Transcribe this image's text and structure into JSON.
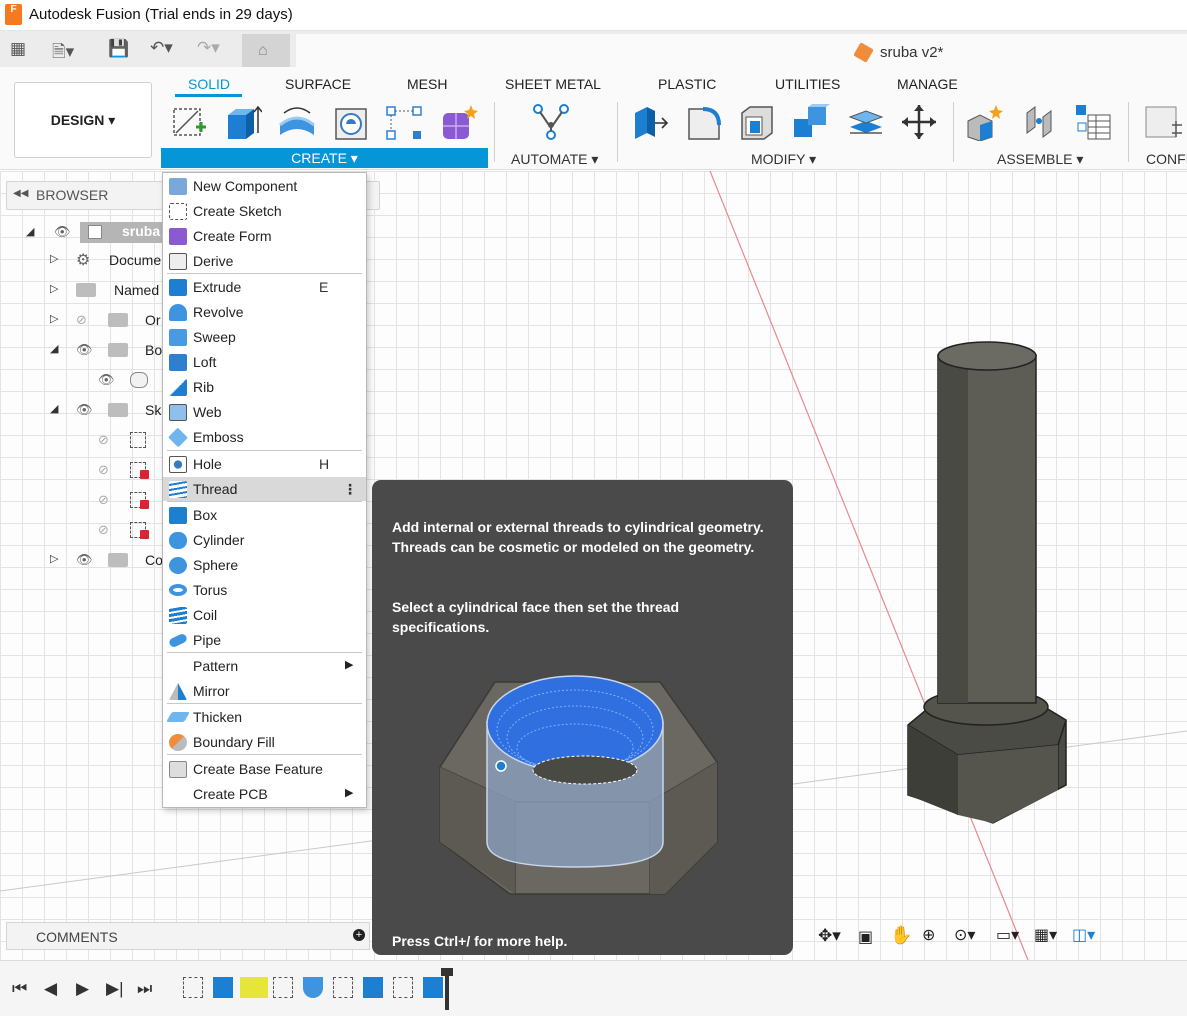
{
  "window": {
    "title": "Autodesk Fusion (Trial ends in 29 days)",
    "app_icon_text": "F"
  },
  "quick_access": {
    "icons": [
      "grid-icon",
      "file-icon",
      "save-icon",
      "undo-icon",
      "redo-icon",
      "home-icon"
    ]
  },
  "document": {
    "title": "sruba v2*"
  },
  "ribbon": {
    "tabs": [
      "SOLID",
      "SURFACE",
      "MESH",
      "SHEET METAL",
      "PLASTIC",
      "UTILITIES",
      "MANAGE"
    ],
    "active_tab": "SOLID",
    "workspace_button": "DESIGN ▾",
    "groups": {
      "create": "CREATE ▾",
      "automate": "AUTOMATE ▾",
      "modify": "MODIFY ▾",
      "assemble": "ASSEMBLE ▾",
      "configure": "CONFI"
    }
  },
  "browser": {
    "header": "BROWSER",
    "rows": [
      "sruba",
      "Docume",
      "Named",
      "Or",
      "Bo",
      "",
      "Sk",
      "",
      "",
      "",
      "",
      "Co"
    ]
  },
  "create_menu": {
    "items": [
      {
        "label": "New Component",
        "shortcut": ""
      },
      {
        "label": "Create Sketch",
        "shortcut": ""
      },
      {
        "label": "Create Form",
        "shortcut": ""
      },
      {
        "label": "Derive",
        "shortcut": ""
      },
      {
        "label": "Extrude",
        "shortcut": "E"
      },
      {
        "label": "Revolve",
        "shortcut": ""
      },
      {
        "label": "Sweep",
        "shortcut": ""
      },
      {
        "label": "Loft",
        "shortcut": ""
      },
      {
        "label": "Rib",
        "shortcut": ""
      },
      {
        "label": "Web",
        "shortcut": ""
      },
      {
        "label": "Emboss",
        "shortcut": ""
      },
      {
        "label": "Hole",
        "shortcut": "H"
      },
      {
        "label": "Thread",
        "shortcut": "⋮"
      },
      {
        "label": "Box",
        "shortcut": ""
      },
      {
        "label": "Cylinder",
        "shortcut": ""
      },
      {
        "label": "Sphere",
        "shortcut": ""
      },
      {
        "label": "Torus",
        "shortcut": ""
      },
      {
        "label": "Coil",
        "shortcut": ""
      },
      {
        "label": "Pipe",
        "shortcut": ""
      },
      {
        "label": "Pattern",
        "shortcut": ""
      },
      {
        "label": "Mirror",
        "shortcut": ""
      },
      {
        "label": "Thicken",
        "shortcut": ""
      },
      {
        "label": "Boundary Fill",
        "shortcut": ""
      },
      {
        "label": "Create Base Feature",
        "shortcut": ""
      },
      {
        "label": "Create PCB",
        "shortcut": ""
      }
    ]
  },
  "tooltip": {
    "paragraph1": "Add internal or external threads to cylindrical geometry. Threads can be cosmetic or modeled on the geometry.",
    "paragraph2": "Select a cylindrical face then set the thread specifications.",
    "footer": "Press Ctrl+/ for more help."
  },
  "comments": {
    "label": "COMMENTS"
  },
  "colors": {
    "accent": "#0696d7",
    "tooltip_bg": "#4a4a4a",
    "model_gray": "#5a5a52",
    "thread_blue": "#2f6fe0"
  }
}
